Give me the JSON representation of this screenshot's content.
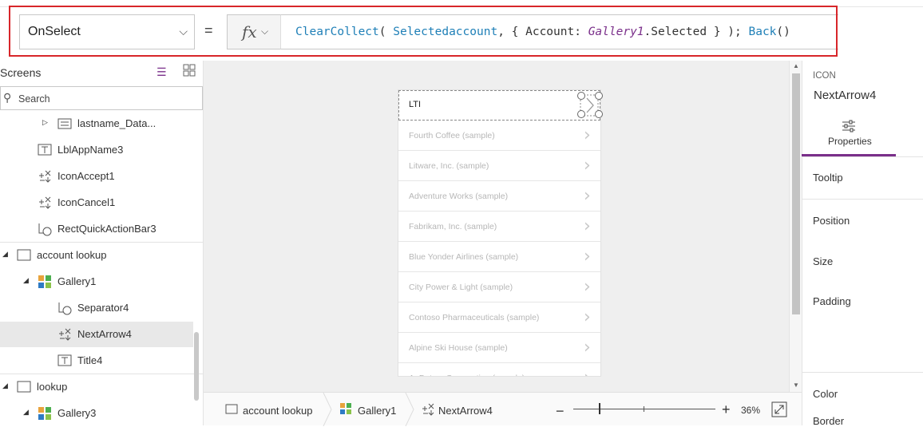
{
  "formula_bar": {
    "property": "OnSelect",
    "equals": "=",
    "fx": "fx",
    "formula_parts": [
      {
        "t": "ClearCollect",
        "k": "fn"
      },
      {
        "t": "( ",
        "k": "p"
      },
      {
        "t": "Selectedaccount",
        "k": "fn"
      },
      {
        "t": ", { Account: ",
        "k": "p"
      },
      {
        "t": "Gallery1",
        "k": "it"
      },
      {
        "t": ".Selected } ); ",
        "k": "p"
      },
      {
        "t": "Back",
        "k": "fn"
      },
      {
        "t": "()",
        "k": "p"
      }
    ]
  },
  "tree": {
    "title": "Screens",
    "search_placeholder": "Search",
    "items": [
      {
        "label": "lastname_Data...",
        "icon": "form-icon",
        "arrow": "▷"
      },
      {
        "label": "LblAppName3",
        "icon": "label-icon"
      },
      {
        "label": "IconAccept1",
        "icon": "icon-control-icon"
      },
      {
        "label": "IconCancel1",
        "icon": "icon-control-icon"
      },
      {
        "label": "RectQuickActionBar3",
        "icon": "shape-icon"
      },
      {
        "label": "account lookup",
        "icon": "screen-icon",
        "arrow": "◢"
      },
      {
        "label": "Gallery1",
        "icon": "gallery-icon",
        "arrow": "◢"
      },
      {
        "label": "Separator4",
        "icon": "shape-icon"
      },
      {
        "label": "NextArrow4",
        "icon": "icon-control-icon"
      },
      {
        "label": "Title4",
        "icon": "label-icon"
      },
      {
        "label": "lookup",
        "icon": "screen-icon",
        "arrow": "◢"
      },
      {
        "label": "Gallery3",
        "icon": "gallery-icon",
        "arrow": "◢"
      }
    ]
  },
  "gallery": {
    "items": [
      "LTI",
      "Fourth Coffee (sample)",
      "Litware, Inc. (sample)",
      "Adventure Works (sample)",
      "Fabrikam, Inc. (sample)",
      "Blue Yonder Airlines (sample)",
      "City Power & Light (sample)",
      "Contoso Pharmaceuticals (sample)",
      "Alpine Ski House (sample)",
      "A. Datum Corporation (sample)"
    ]
  },
  "status": {
    "breadcrumbs": [
      "account lookup",
      "Gallery1",
      "NextArrow4"
    ],
    "zoom": "36%",
    "zoom_fraction": 0.18
  },
  "right_panel": {
    "control_type": "ICON",
    "control_name": "NextArrow4",
    "tab_label": "Properties",
    "labels": [
      "Tooltip",
      "Position",
      "Size",
      "Padding",
      "Color",
      "Border"
    ]
  },
  "colors": {
    "accent": "#7a2f8a",
    "highlight_frame": "#d8262a",
    "function": "#1e7fb7"
  }
}
